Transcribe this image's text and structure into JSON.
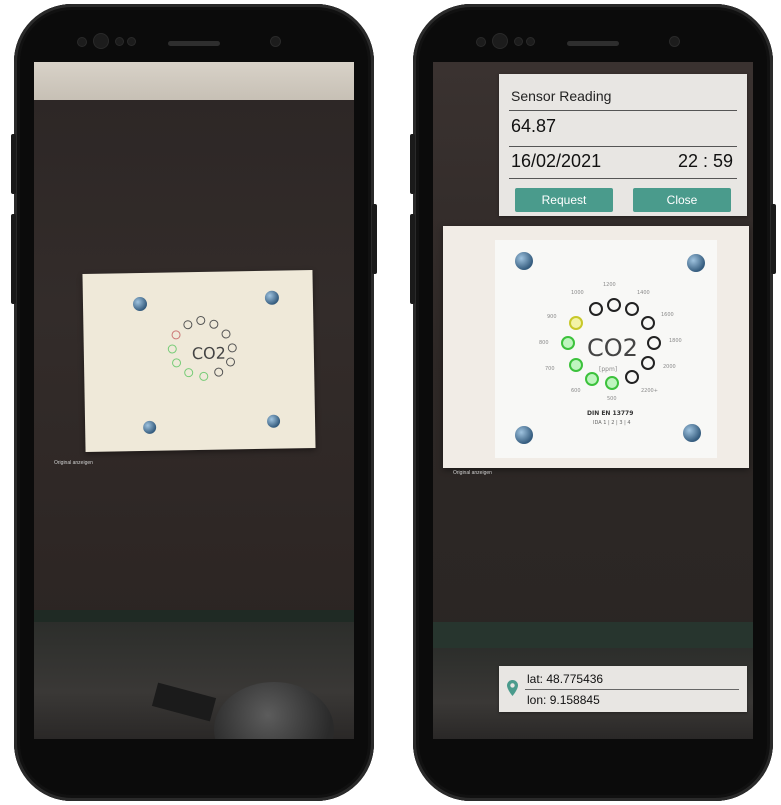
{
  "left_phone": {
    "sensor_card": {
      "center_label": "CO2",
      "caption": "Original anzeigen"
    }
  },
  "right_phone": {
    "sensor_panel": {
      "title": "Sensor Reading",
      "value": "64.87",
      "date": "16/02/2021",
      "time": "22 : 59",
      "request_label": "Request",
      "close_label": "Close"
    },
    "sensor_card": {
      "center_label": "CO2",
      "unit_label": "[ppm]",
      "footer_line1": "DIN EN 13779",
      "footer_line2": "IDA 1 | 2 | 3 | 4",
      "caption": "Original anzeigen",
      "scale_labels": [
        "1200",
        "1400",
        "1600",
        "1800",
        "2000",
        "2200+",
        "500",
        "600",
        "700",
        "800",
        "900",
        "1000"
      ]
    },
    "location_panel": {
      "lat_label": "lat:",
      "lat_value": "48.775436",
      "lon_label": "lon:",
      "lon_value": "9.158845",
      "pin_icon": "map-pin-icon",
      "accent_color": "#4a9b8c"
    }
  },
  "colors": {
    "button": "#4a9b8c",
    "panel_bg": "#e8e6e3",
    "led_green": "#4ad14a",
    "led_yellow": "#d9d93a",
    "ring_off": "#222222"
  }
}
